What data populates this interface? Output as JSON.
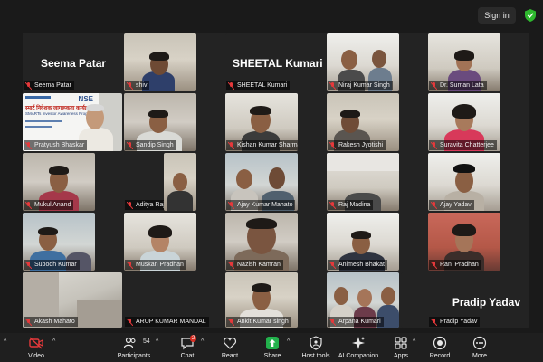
{
  "header": {
    "signin_label": "Sign in",
    "shield_icon": "shield-check-icon",
    "shield_color": "#2eb82e"
  },
  "tiles": {
    "seema": {
      "name": "Seema Patar",
      "big": "Seema Patar"
    },
    "shiv": {
      "name": "shiv"
    },
    "sheetal": {
      "name": "SHEETAL Kumari",
      "big": "SHEETAL Kumari"
    },
    "niraj": {
      "name": "Niraj Kumar Singh"
    },
    "suman": {
      "name": "Dr. Suman Lata"
    },
    "pratyush": {
      "name": "Pratyush Bhaskar"
    },
    "sandip": {
      "name": "Sandip Singh"
    },
    "kishan": {
      "name": "Kishan Kumar Sharma"
    },
    "rakesh": {
      "name": "Rakesh Jyotishi"
    },
    "suravita": {
      "name": "Suravita Chatterjee"
    },
    "mukul": {
      "name": "Mukul Anand"
    },
    "aditya": {
      "name": "Aditya Raj"
    },
    "ajaym": {
      "name": "Ajay Kumar Mahato"
    },
    "raj": {
      "name": "Raj Madina"
    },
    "ajayy": {
      "name": "Ajay Yadav"
    },
    "subodh": {
      "name": "Subodh Kumar"
    },
    "muskan": {
      "name": "Muskan Pradhan"
    },
    "nazish": {
      "name": "Nazish Kamran"
    },
    "animesh": {
      "name": "Animesh Bhakat"
    },
    "rani": {
      "name": "Rani Pradhan"
    },
    "akash": {
      "name": "Akash Mahato"
    },
    "arup": {
      "name": "ARUP KUMAR MANDAL"
    },
    "ankit": {
      "name": "Ankit Kumar singh"
    },
    "arpana": {
      "name": "Arpana Kumari"
    },
    "pradip": {
      "name": "Pradip Yadav",
      "big": "Pradip Yadav"
    }
  },
  "presentation": {
    "logo": "NSE",
    "hindi_line": "स्मार्ट निवेशक जागरूकता कार्यक्रम",
    "english_line": "SMARTs Investor Awareness Program"
  },
  "toolbar": {
    "video_label": "Video",
    "participants_label": "Participants",
    "participants_count": "54",
    "chat_label": "Chat",
    "chat_badge": "2",
    "react_label": "React",
    "share_label": "Share",
    "hosttools_label": "Host tools",
    "ai_label": "AI Companion",
    "apps_label": "Apps",
    "record_label": "Record",
    "more_label": "More",
    "colors": {
      "muted_red": "#e5393b",
      "share_green": "#22b14c",
      "badge_red": "#d93025"
    }
  }
}
